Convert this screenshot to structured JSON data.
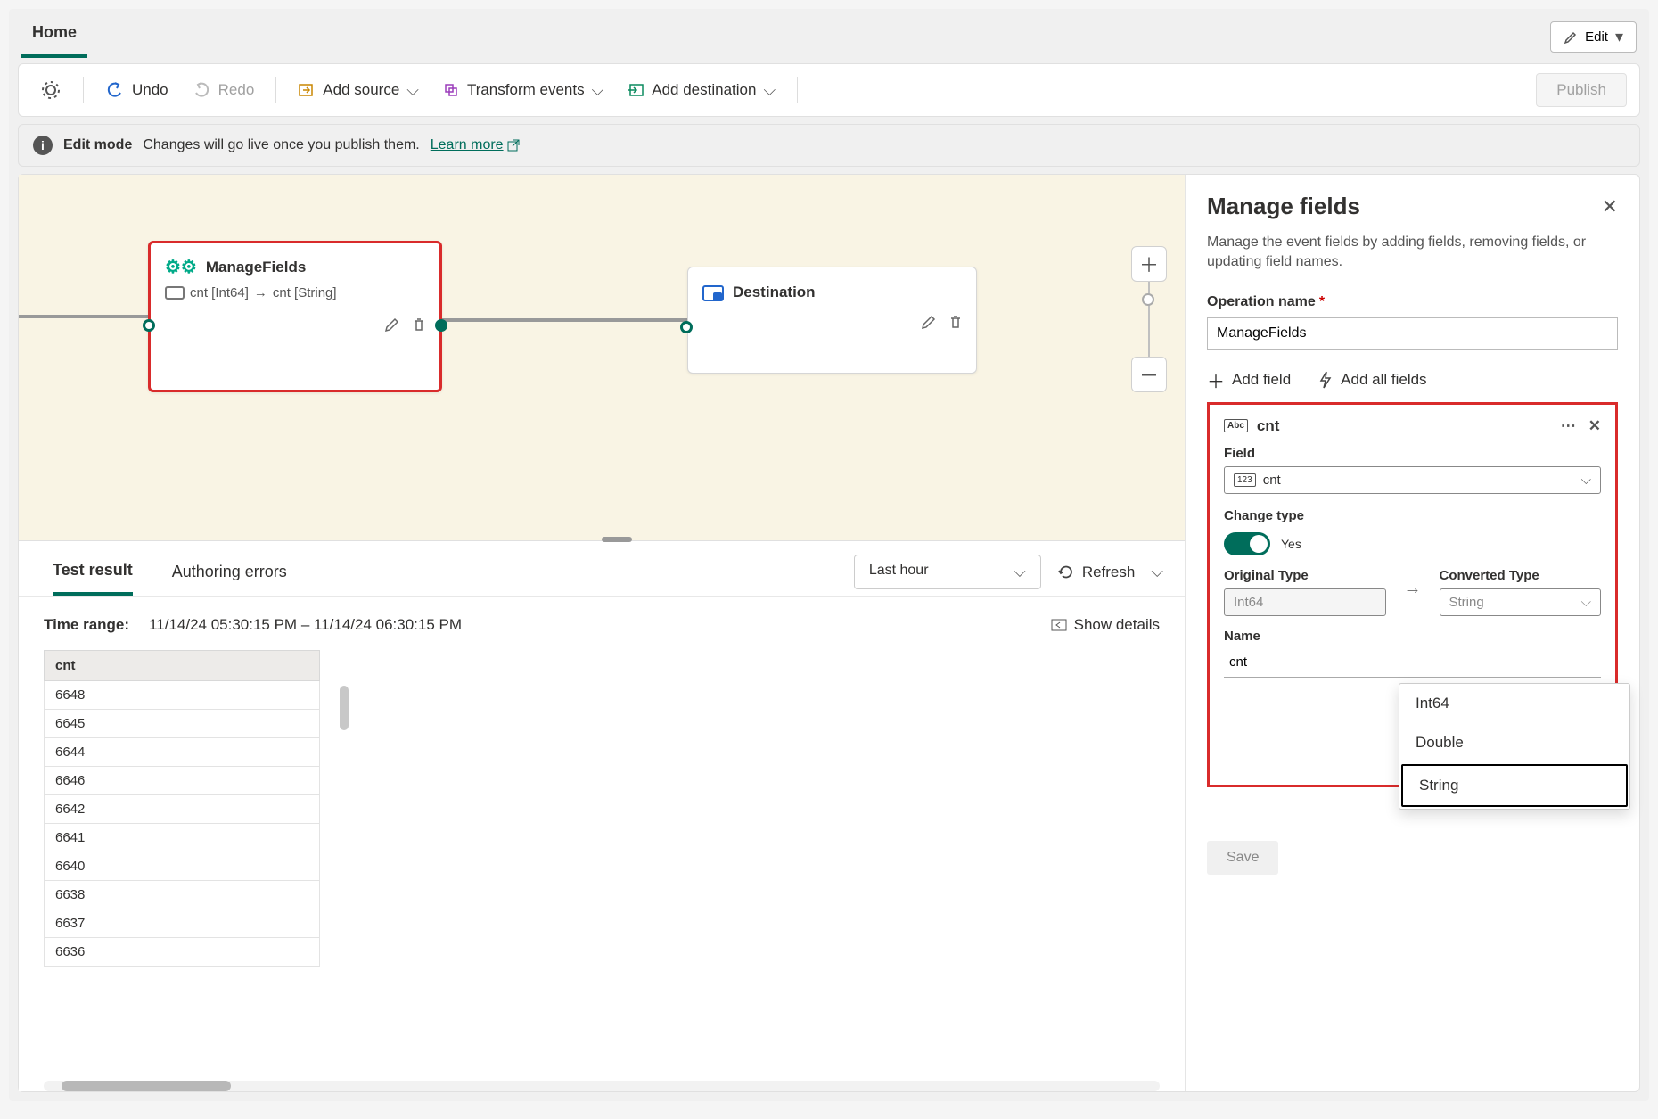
{
  "nav": {
    "home": "Home",
    "edit_label": "Edit"
  },
  "toolbar": {
    "undo": "Undo",
    "redo": "Redo",
    "add_source": "Add source",
    "transform": "Transform events",
    "add_destination": "Add destination",
    "publish": "Publish"
  },
  "info_bar": {
    "mode": "Edit mode",
    "msg": "Changes will go live once you publish them.",
    "learn_more": "Learn more"
  },
  "canvas": {
    "manage_fields_node": {
      "title": "ManageFields",
      "body_from": "cnt [Int64]",
      "body_to": "cnt [String]"
    },
    "destination_node": {
      "title": "Destination"
    }
  },
  "bottom": {
    "tab1": "Test result",
    "tab2": "Authoring errors",
    "time_select": "Last hour",
    "refresh": "Refresh",
    "time_range_label": "Time range:",
    "time_range_value": "11/14/24 05:30:15 PM  –  11/14/24 06:30:15 PM",
    "show_details": "Show details",
    "table_header": "cnt",
    "rows": [
      "6648",
      "6645",
      "6644",
      "6646",
      "6642",
      "6641",
      "6640",
      "6638",
      "6637",
      "6636"
    ]
  },
  "right_panel": {
    "title": "Manage fields",
    "desc": "Manage the event fields by adding fields, removing fields, or updating field names.",
    "op_name_label": "Operation name",
    "op_name_value": "ManageFields",
    "add_field": "Add field",
    "add_all": "Add all fields",
    "cfg": {
      "name": "cnt",
      "field_label": "Field",
      "field_value": "cnt",
      "change_type_label": "Change type",
      "change_type_yes": "Yes",
      "orig_label": "Original Type",
      "orig_value": "Int64",
      "conv_label": "Converted Type",
      "conv_value": "String",
      "options": [
        "Int64",
        "Double",
        "String"
      ],
      "name_field_label": "Name",
      "name_field_value": "cnt"
    },
    "save": "Save"
  }
}
